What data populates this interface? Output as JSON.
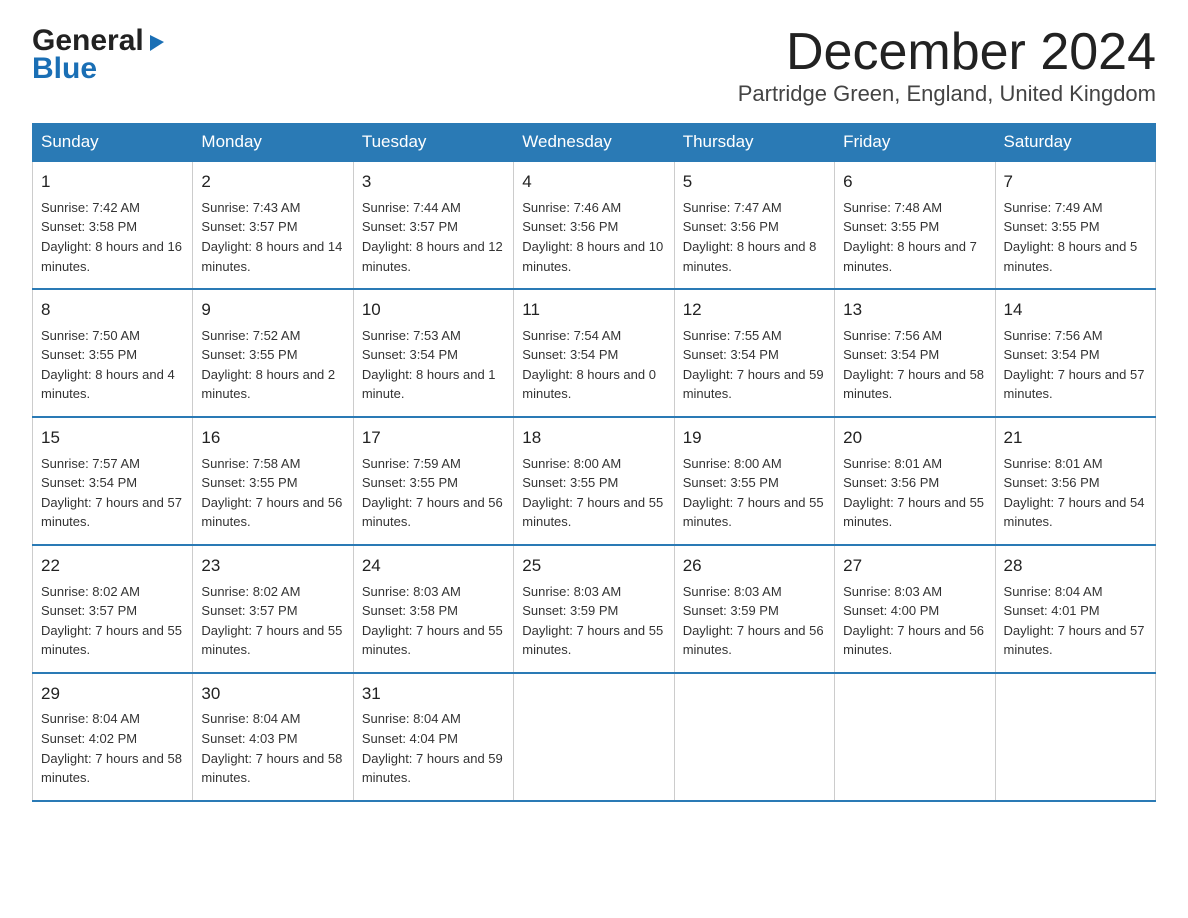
{
  "logo": {
    "general": "General",
    "triangle_char": "▶",
    "blue": "Blue"
  },
  "title": "December 2024",
  "subtitle": "Partridge Green, England, United Kingdom",
  "days_header": [
    "Sunday",
    "Monday",
    "Tuesday",
    "Wednesday",
    "Thursday",
    "Friday",
    "Saturday"
  ],
  "weeks": [
    [
      {
        "num": "1",
        "sunrise": "7:42 AM",
        "sunset": "3:58 PM",
        "daylight": "8 hours and 16 minutes."
      },
      {
        "num": "2",
        "sunrise": "7:43 AM",
        "sunset": "3:57 PM",
        "daylight": "8 hours and 14 minutes."
      },
      {
        "num": "3",
        "sunrise": "7:44 AM",
        "sunset": "3:57 PM",
        "daylight": "8 hours and 12 minutes."
      },
      {
        "num": "4",
        "sunrise": "7:46 AM",
        "sunset": "3:56 PM",
        "daylight": "8 hours and 10 minutes."
      },
      {
        "num": "5",
        "sunrise": "7:47 AM",
        "sunset": "3:56 PM",
        "daylight": "8 hours and 8 minutes."
      },
      {
        "num": "6",
        "sunrise": "7:48 AM",
        "sunset": "3:55 PM",
        "daylight": "8 hours and 7 minutes."
      },
      {
        "num": "7",
        "sunrise": "7:49 AM",
        "sunset": "3:55 PM",
        "daylight": "8 hours and 5 minutes."
      }
    ],
    [
      {
        "num": "8",
        "sunrise": "7:50 AM",
        "sunset": "3:55 PM",
        "daylight": "8 hours and 4 minutes."
      },
      {
        "num": "9",
        "sunrise": "7:52 AM",
        "sunset": "3:55 PM",
        "daylight": "8 hours and 2 minutes."
      },
      {
        "num": "10",
        "sunrise": "7:53 AM",
        "sunset": "3:54 PM",
        "daylight": "8 hours and 1 minute."
      },
      {
        "num": "11",
        "sunrise": "7:54 AM",
        "sunset": "3:54 PM",
        "daylight": "8 hours and 0 minutes."
      },
      {
        "num": "12",
        "sunrise": "7:55 AM",
        "sunset": "3:54 PM",
        "daylight": "7 hours and 59 minutes."
      },
      {
        "num": "13",
        "sunrise": "7:56 AM",
        "sunset": "3:54 PM",
        "daylight": "7 hours and 58 minutes."
      },
      {
        "num": "14",
        "sunrise": "7:56 AM",
        "sunset": "3:54 PM",
        "daylight": "7 hours and 57 minutes."
      }
    ],
    [
      {
        "num": "15",
        "sunrise": "7:57 AM",
        "sunset": "3:54 PM",
        "daylight": "7 hours and 57 minutes."
      },
      {
        "num": "16",
        "sunrise": "7:58 AM",
        "sunset": "3:55 PM",
        "daylight": "7 hours and 56 minutes."
      },
      {
        "num": "17",
        "sunrise": "7:59 AM",
        "sunset": "3:55 PM",
        "daylight": "7 hours and 56 minutes."
      },
      {
        "num": "18",
        "sunrise": "8:00 AM",
        "sunset": "3:55 PM",
        "daylight": "7 hours and 55 minutes."
      },
      {
        "num": "19",
        "sunrise": "8:00 AM",
        "sunset": "3:55 PM",
        "daylight": "7 hours and 55 minutes."
      },
      {
        "num": "20",
        "sunrise": "8:01 AM",
        "sunset": "3:56 PM",
        "daylight": "7 hours and 55 minutes."
      },
      {
        "num": "21",
        "sunrise": "8:01 AM",
        "sunset": "3:56 PM",
        "daylight": "7 hours and 54 minutes."
      }
    ],
    [
      {
        "num": "22",
        "sunrise": "8:02 AM",
        "sunset": "3:57 PM",
        "daylight": "7 hours and 55 minutes."
      },
      {
        "num": "23",
        "sunrise": "8:02 AM",
        "sunset": "3:57 PM",
        "daylight": "7 hours and 55 minutes."
      },
      {
        "num": "24",
        "sunrise": "8:03 AM",
        "sunset": "3:58 PM",
        "daylight": "7 hours and 55 minutes."
      },
      {
        "num": "25",
        "sunrise": "8:03 AM",
        "sunset": "3:59 PM",
        "daylight": "7 hours and 55 minutes."
      },
      {
        "num": "26",
        "sunrise": "8:03 AM",
        "sunset": "3:59 PM",
        "daylight": "7 hours and 56 minutes."
      },
      {
        "num": "27",
        "sunrise": "8:03 AM",
        "sunset": "4:00 PM",
        "daylight": "7 hours and 56 minutes."
      },
      {
        "num": "28",
        "sunrise": "8:04 AM",
        "sunset": "4:01 PM",
        "daylight": "7 hours and 57 minutes."
      }
    ],
    [
      {
        "num": "29",
        "sunrise": "8:04 AM",
        "sunset": "4:02 PM",
        "daylight": "7 hours and 58 minutes."
      },
      {
        "num": "30",
        "sunrise": "8:04 AM",
        "sunset": "4:03 PM",
        "daylight": "7 hours and 58 minutes."
      },
      {
        "num": "31",
        "sunrise": "8:04 AM",
        "sunset": "4:04 PM",
        "daylight": "7 hours and 59 minutes."
      },
      null,
      null,
      null,
      null
    ]
  ],
  "labels": {
    "sunrise": "Sunrise:",
    "sunset": "Sunset:",
    "daylight": "Daylight:"
  }
}
